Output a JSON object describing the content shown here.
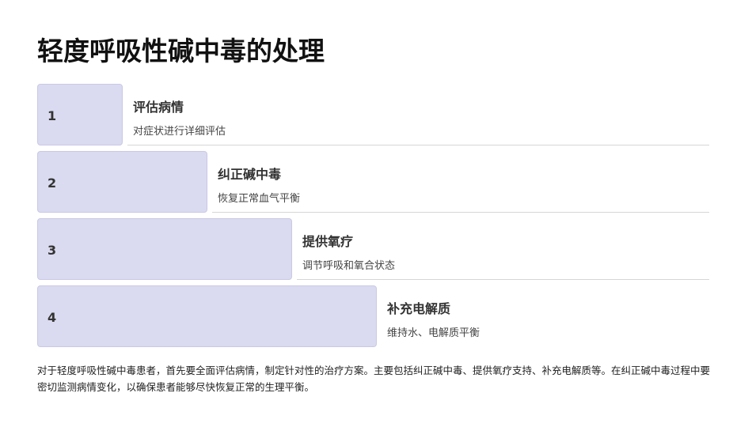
{
  "title": "轻度呼吸性碱中毒的处理",
  "steps": [
    {
      "number": "1",
      "heading": "评估病情",
      "description": "对症状进行详细评估"
    },
    {
      "number": "2",
      "heading": "纠正碱中毒",
      "description": "恢复正常血气平衡"
    },
    {
      "number": "3",
      "heading": "提供氧疗",
      "description": "调节呼吸和氧合状态"
    },
    {
      "number": "4",
      "heading": "补充电解质",
      "description": "维持水、电解质平衡"
    }
  ],
  "summary": "对于轻度呼吸性碱中毒患者，首先要全面评估病情，制定针对性的治疗方案。主要包括纠正碱中毒、提供氧疗支持、补充电解质等。在纠正碱中毒过程中要密切监测病情变化，以确保患者能够尽快恢复正常的生理平衡。"
}
